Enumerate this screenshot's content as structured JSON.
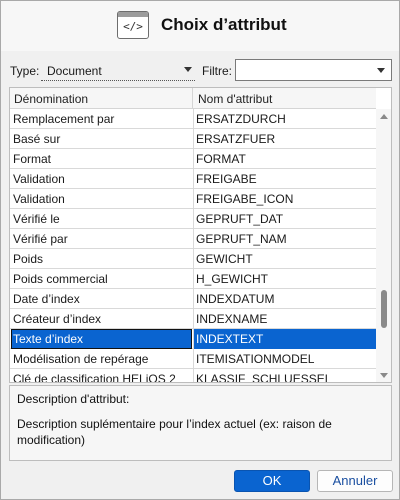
{
  "dialog": {
    "title": "Choix d’attribut",
    "title_icon_glyph": "</>"
  },
  "filters": {
    "type_label": "Type:",
    "type_value": "Document",
    "filter_label": "Filtre:",
    "filter_value": ""
  },
  "table": {
    "columns": [
      "Dénomination",
      "Nom d'attribut"
    ],
    "rows": [
      [
        "Remplacement par",
        "ERSATZDURCH"
      ],
      [
        "Basé sur",
        "ERSATZFUER"
      ],
      [
        "Format",
        "FORMAT"
      ],
      [
        "Validation",
        "FREIGABE"
      ],
      [
        "Validation",
        "FREIGABE_ICON"
      ],
      [
        "Vérifié le",
        "GEPRUFT_DAT"
      ],
      [
        "Vérifié par",
        "GEPRUFT_NAM"
      ],
      [
        "Poids",
        "GEWICHT"
      ],
      [
        "Poids commercial",
        "H_GEWICHT"
      ],
      [
        "Date d’index",
        "INDEXDATUM"
      ],
      [
        "Créateur d’index",
        "INDEXNAME"
      ],
      [
        "Texte d’index",
        "INDEXTEXT"
      ],
      [
        "Modélisation de repérage",
        "ITEMISATIONMODEL"
      ],
      [
        "Clé de classification HELiOS 2",
        "KLASSIF_SCHLUESSEL"
      ]
    ],
    "selected_row": 11
  },
  "description": {
    "label": "Description d'attribut:",
    "text": "Description suplémentaire pour l’index actuel (ex: raison de modification)"
  },
  "buttons": {
    "ok": "OK",
    "cancel": "Annuler"
  },
  "colors": {
    "accent": "#0a64d0",
    "background": "#f0f0f0"
  }
}
